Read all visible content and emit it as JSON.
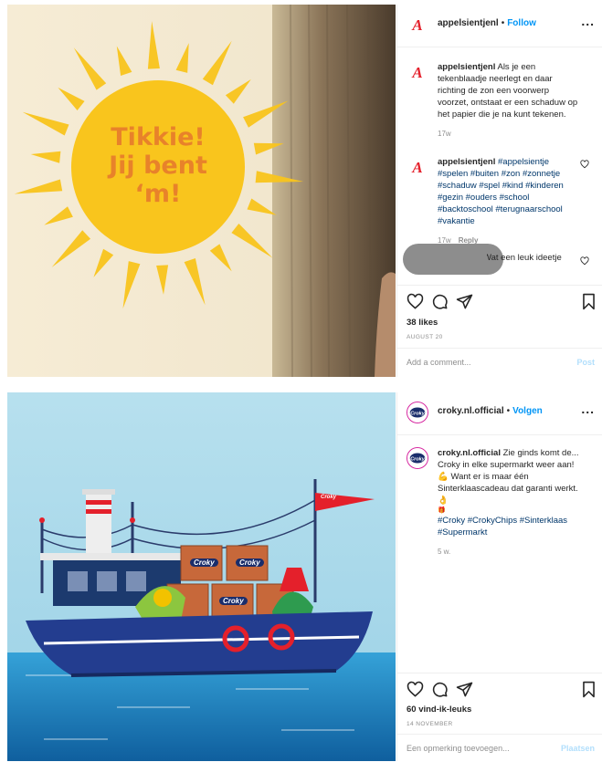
{
  "post1": {
    "image": {
      "sun_text": [
        "Tikkie!",
        "Jij bent",
        "‘m!"
      ],
      "sun_color": "#f9c51d",
      "text_color": "#e8822a"
    },
    "header": {
      "username": "appelsientjenl",
      "dot": "•",
      "follow_label": "Follow",
      "more": "..."
    },
    "caption": {
      "username": "appelsientjenl",
      "text": "Als je een tekenblaadje neerlegt en daar richting de zon een voorwerp voorzet, ontstaat er een schaduw op het papier die je na kunt tekenen.",
      "time": "17w"
    },
    "comment": {
      "username": "appelsientjenl",
      "tags": "#appelsientje #spelen #buiten #zon #zonnetje #schaduw #spel #kind #kinderen #gezin #ouders #school #backtoschool #terugnaarschool #vakantie",
      "time": "17w",
      "reply": "Reply"
    },
    "comment2": {
      "text": "Wat een leuk ideetje"
    },
    "likes": "38 likes",
    "date": "AUGUST 20",
    "add_comment_placeholder": "Add a comment...",
    "post_button": "Post"
  },
  "post2": {
    "image": {
      "brand": "Croky"
    },
    "header": {
      "username": "croky.nl.official",
      "dot": "•",
      "follow_label": "Volgen",
      "more": "..."
    },
    "caption": {
      "username": "croky.nl.official",
      "text": "Zie ginds komt de... Croky in elke supermarkt weer aan! 💪 Want er is maar één Sinterklaascadeau dat garanti werkt. 👌",
      "extra": "🎁",
      "tags": "#Croky #CrokyChips #Sinterklaas #Supermarkt",
      "time": "5 w."
    },
    "likes": "60 vind-ik-leuks",
    "date": "14 NOVEMBER",
    "add_comment_placeholder": "Een opmerking toevoegen...",
    "post_button": "Plaatsen"
  },
  "colors": {
    "link_blue": "#0095f6",
    "brand_red": "#e4202b",
    "sea": "#1e7fc7",
    "sky": "#a9d8ea"
  }
}
